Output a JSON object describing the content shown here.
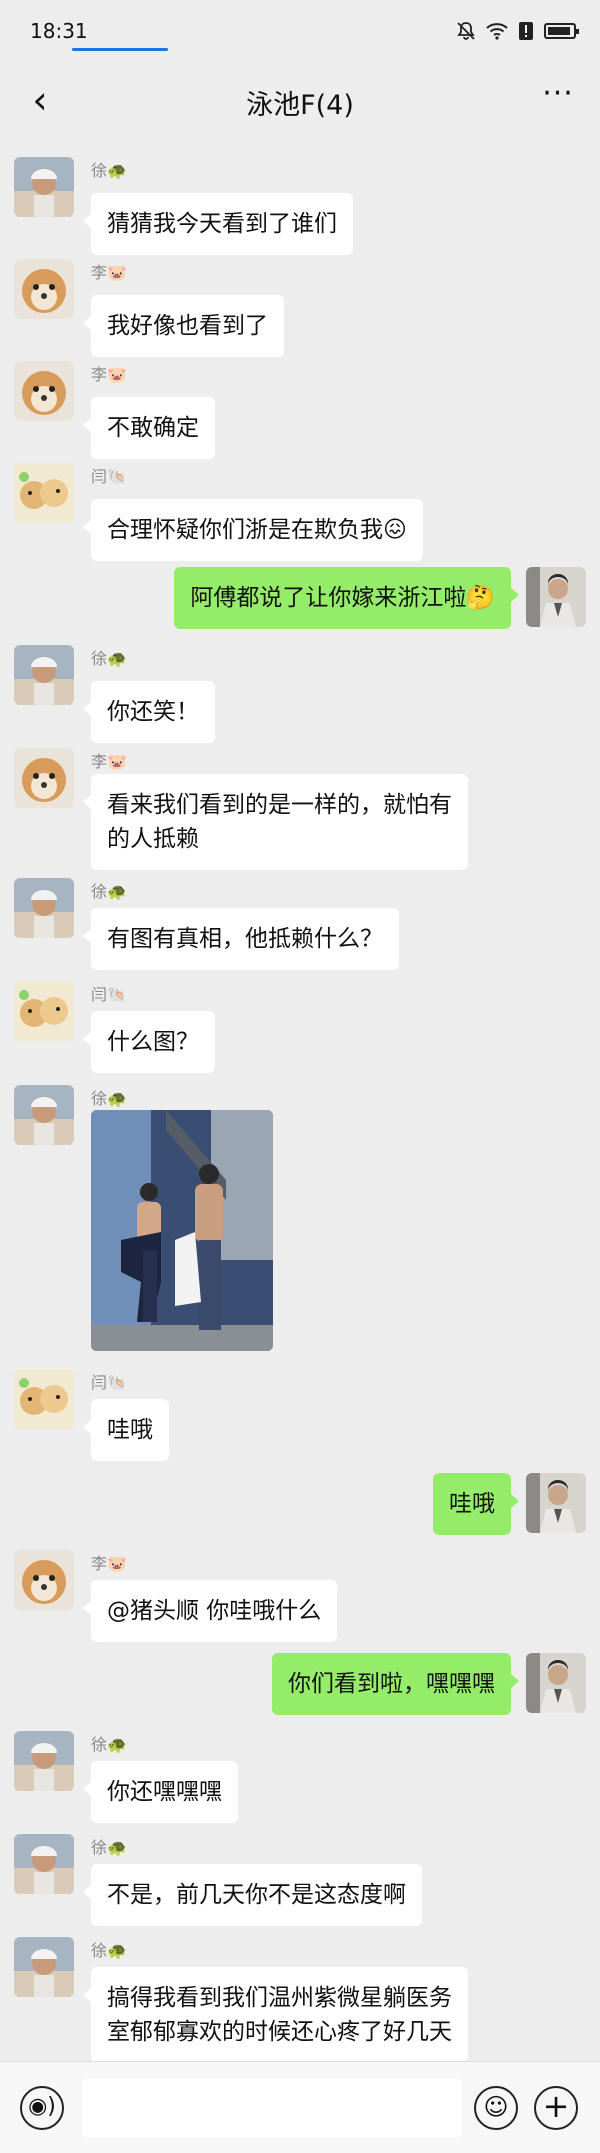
{
  "status_bar": {
    "time": "18:31",
    "mute_icon": "bell-off-icon",
    "wifi_icon": "wifi-icon",
    "alert_icon": "alert-icon",
    "battery_icon": "battery-icon"
  },
  "nav": {
    "title": "泳池F(4)",
    "back_icon": "chevron-left-icon",
    "more_icon": "ellipsis-icon",
    "back_glyph": "‹",
    "more_glyph": "···"
  },
  "colors": {
    "incoming_bubble": "#ffffff",
    "outgoing_bubble": "#95ec69",
    "background": "#ededed"
  },
  "messages": [
    {
      "sender": "徐🐢",
      "text": "猜猜我今天看到了谁们",
      "direction": "in",
      "avatar": "cyclist-avatar"
    },
    {
      "sender": "李🐷",
      "text": "我好像也看到了",
      "direction": "in",
      "avatar": "dog-avatar"
    },
    {
      "sender": "李🐷",
      "text": "不敢确定",
      "direction": "in",
      "avatar": "dog-avatar"
    },
    {
      "sender": "闫🐚",
      "text": "合理怀疑你们浙是在欺负我😖",
      "direction": "in",
      "avatar": "puppy-avatar"
    },
    {
      "sender": "",
      "text": "阿傅都说了让你嫁来浙江啦🤔",
      "direction": "out",
      "avatar": "self-avatar"
    },
    {
      "sender": "徐🐢",
      "text": "你还笑！",
      "direction": "in",
      "avatar": "cyclist-avatar"
    },
    {
      "sender": "李🐷",
      "text_line1": "看来我们看到的是一样的，就怕有",
      "text_line2": "的人抵赖",
      "direction": "in",
      "avatar": "dog-avatar"
    },
    {
      "sender": "徐🐢",
      "text": "有图有真相，他抵赖什么？",
      "direction": "in",
      "avatar": "cyclist-avatar"
    },
    {
      "sender": "闫🐚",
      "text": "什么图？",
      "direction": "in",
      "avatar": "puppy-avatar"
    },
    {
      "sender": "徐🐢",
      "type": "image",
      "direction": "in",
      "avatar": "cyclist-avatar"
    },
    {
      "sender": "闫🐚",
      "text": "哇哦",
      "direction": "in",
      "avatar": "puppy-avatar"
    },
    {
      "sender": "",
      "text": "哇哦",
      "direction": "out",
      "avatar": "self-avatar"
    },
    {
      "sender": "李🐷",
      "text": "@猪头顺 你哇哦什么",
      "direction": "in",
      "avatar": "dog-avatar"
    },
    {
      "sender": "",
      "text": "你们看到啦，嘿嘿嘿",
      "direction": "out",
      "avatar": "self-avatar"
    },
    {
      "sender": "徐🐢",
      "text": "你还嘿嘿嘿",
      "direction": "in",
      "avatar": "cyclist-avatar"
    },
    {
      "sender": "徐🐢",
      "text": "不是，前几天你不是这态度啊",
      "direction": "in",
      "avatar": "cyclist-avatar"
    },
    {
      "sender": "徐🐢",
      "text_line1": "搞得我看到我们温州紫微星躺医务",
      "text_line2": "室郁郁寡欢的时候还心疼了好几天",
      "direction": "in",
      "avatar": "cyclist-avatar"
    }
  ],
  "input_bar": {
    "voice_icon": "voice-icon",
    "emoji_icon": "emoji-icon",
    "plus_icon": "plus-icon",
    "voice_glyph": "◉)",
    "emoji_glyph": "☺",
    "plus_glyph": "+"
  }
}
